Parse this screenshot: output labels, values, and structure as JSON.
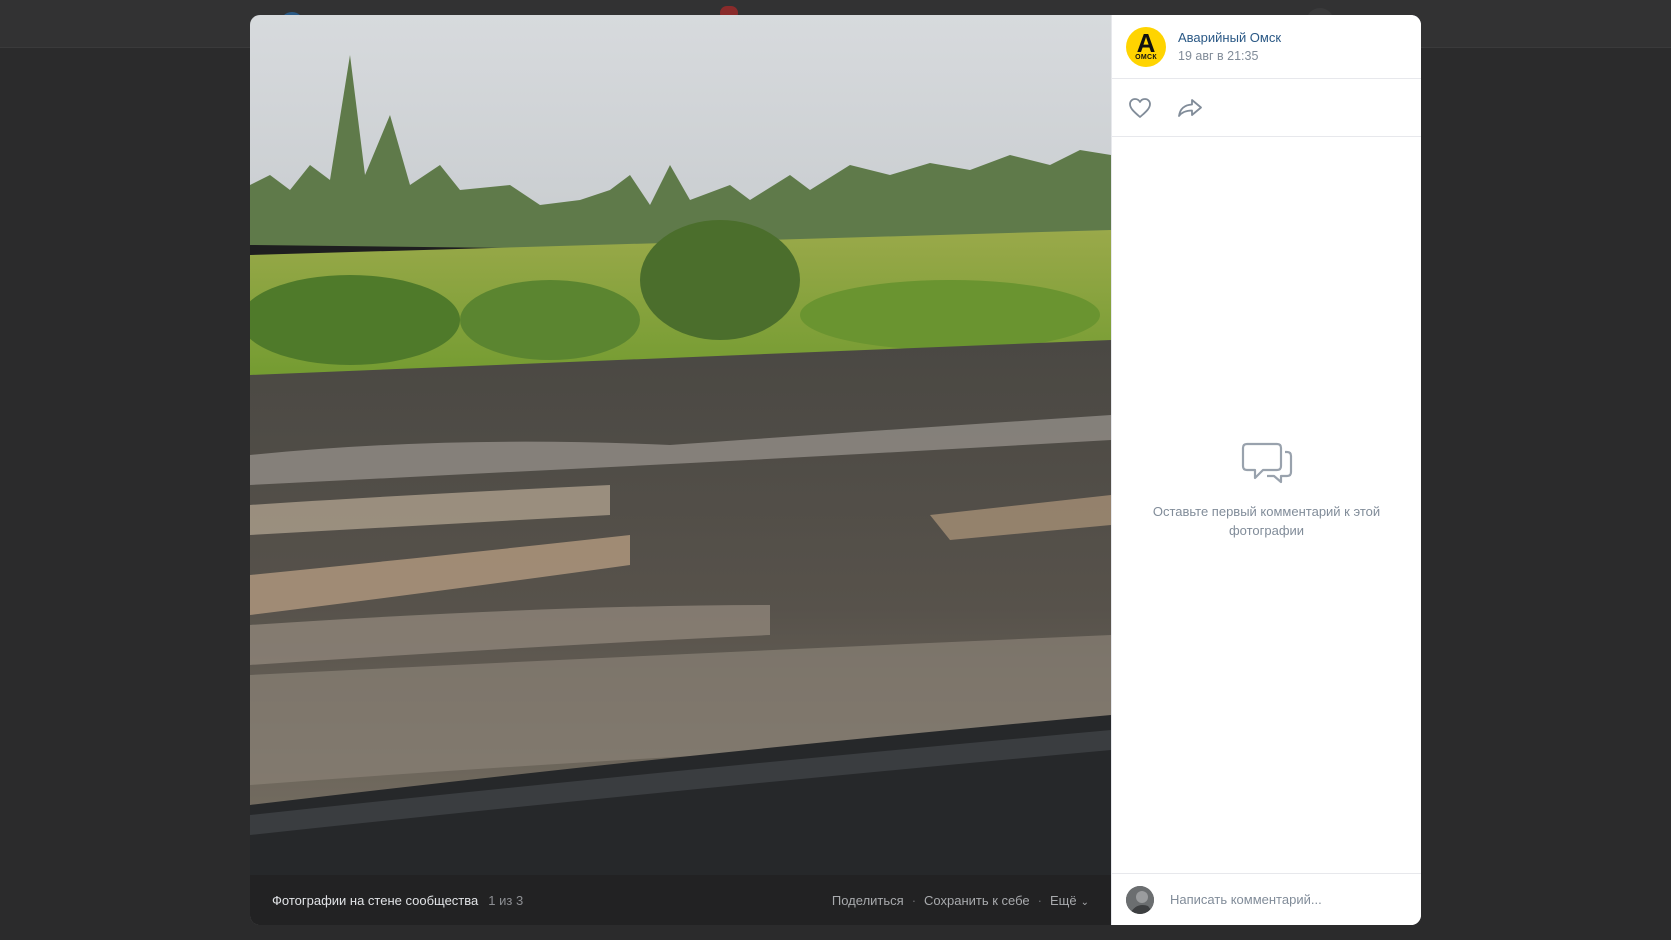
{
  "post": {
    "author": "Аварийный Омск",
    "date": "19 авг в 21:35",
    "avatar_mark": "A",
    "avatar_text": "ОМСК"
  },
  "actions": {
    "like_icon": "heart-icon",
    "share_icon": "share-arrow-icon"
  },
  "comments": {
    "empty_icon": "chat-bubbles-icon",
    "empty_text": "Оставьте первый комментарий к этой фотографии",
    "input_placeholder": "Написать комментарий..."
  },
  "photo_footer": {
    "album_title": "Фотографии на стене сообщества",
    "counter": "1 из 3",
    "share_label": "Поделиться",
    "save_label": "Сохранить к себе",
    "more_label": "Ещё"
  },
  "colors": {
    "link": "#2a5885",
    "muted": "#818c99",
    "avatar_bg": "#ffd400",
    "backdrop": "#2b2b2c"
  }
}
